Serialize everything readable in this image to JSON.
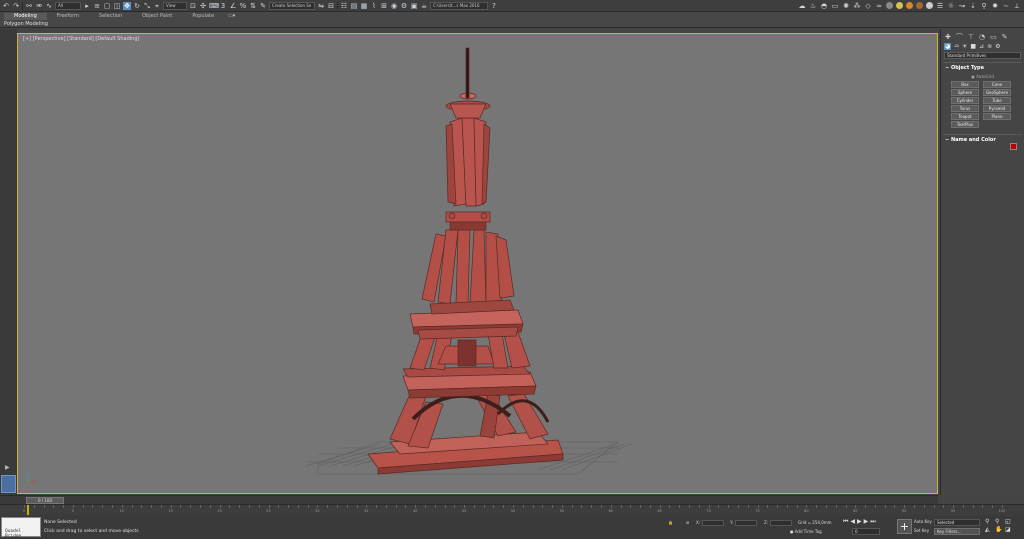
{
  "toolbar": {
    "selection_filter": "All",
    "ref_coord": "View",
    "named_selection": "Create Selection Se",
    "workspace": "C:\\Users\\t...s Max 2016"
  },
  "ribbon": {
    "tabs": [
      "Modeling",
      "Freeform",
      "Selection",
      "Object Paint",
      "Populate"
    ],
    "panel_label": "Polygon Modeling"
  },
  "viewport": {
    "label": "[+] [Perspective] [Standard] [Default Shading]"
  },
  "command_panel": {
    "category": "Standard Primitives",
    "object_type_title": "Object Type",
    "autogrid_label": "AutoGrid",
    "primitives": [
      "Box",
      "Cone",
      "Sphere",
      "GeoSphere",
      "Cylinder",
      "Tube",
      "Torus",
      "Pyramid",
      "Teapot",
      "Plane",
      "TextPlus"
    ],
    "name_color_title": "Name and Color",
    "object_color": "#c00000"
  },
  "timeline": {
    "slider_label": "0 / 100",
    "ticks": [
      "0",
      "5",
      "10",
      "15",
      "20",
      "25",
      "30",
      "35",
      "40",
      "45",
      "50",
      "55",
      "60",
      "65",
      "70",
      "75",
      "80",
      "85",
      "90",
      "95",
      "100"
    ]
  },
  "status": {
    "maxscript_text": "Quadel Bridge",
    "selection_status": "None Selected",
    "prompt": "Click and drag to select and move objects",
    "x_label": "X:",
    "y_label": "Y:",
    "z_label": "Z:",
    "grid": "Grid = 254,0mm",
    "add_time_tag": "Add Time Tag",
    "frame": "0",
    "auto_key": "Auto Key",
    "set_key": "Set Key",
    "selected_option": "Selected",
    "key_filters": "Key Filters..."
  }
}
